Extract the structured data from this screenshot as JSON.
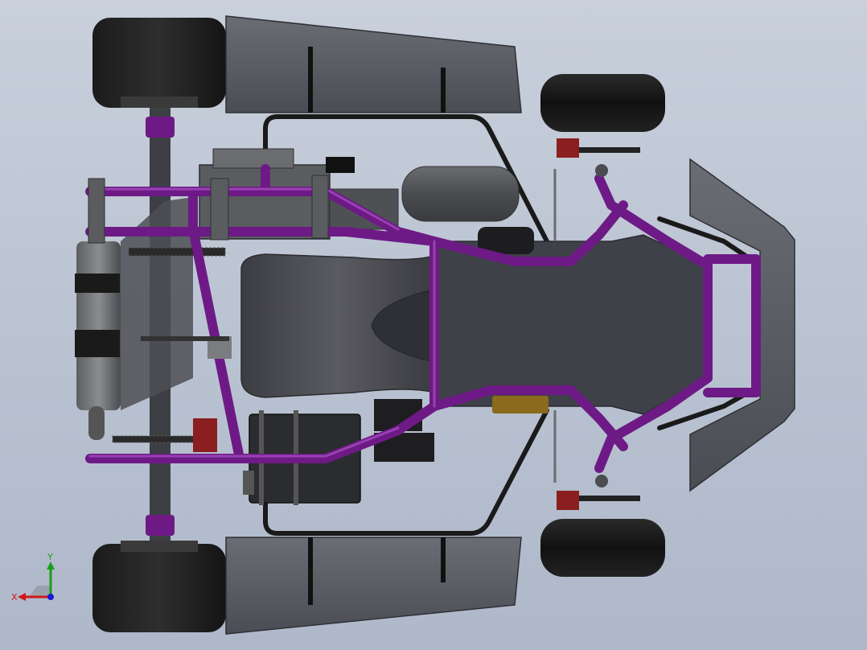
{
  "viewport": {
    "background_top": "#c9d0dc",
    "background_bottom": "#aeb8c9"
  },
  "model": {
    "colors": {
      "frame_tube": "#6e1a86",
      "frame_tube_highlight": "#a24bbd",
      "tire": "#161616",
      "panel": "#55585e",
      "seat": "#4a4b50",
      "floor_tray": "#3e4148",
      "engine_metal": "#5a5c60",
      "brake_caliper": "#8b1f1f",
      "brass_fitting": "#8a6a1c",
      "bumper_rail": "#1a1a1a"
    },
    "components": [
      "rear-left-tire",
      "rear-right-tire",
      "front-left-tire",
      "front-right-tire",
      "left-side-pod",
      "right-side-pod",
      "front-nose-panel",
      "main-frame",
      "seat",
      "floor-tray",
      "engine",
      "exhaust-muffler",
      "battery-box",
      "rear-axle",
      "drive-chain",
      "steering-linkage"
    ]
  },
  "triad": {
    "x_label": "X",
    "y_label": "Y",
    "x_color": "#d01818",
    "y_color": "#18a018",
    "z_color": "#1818d0"
  }
}
